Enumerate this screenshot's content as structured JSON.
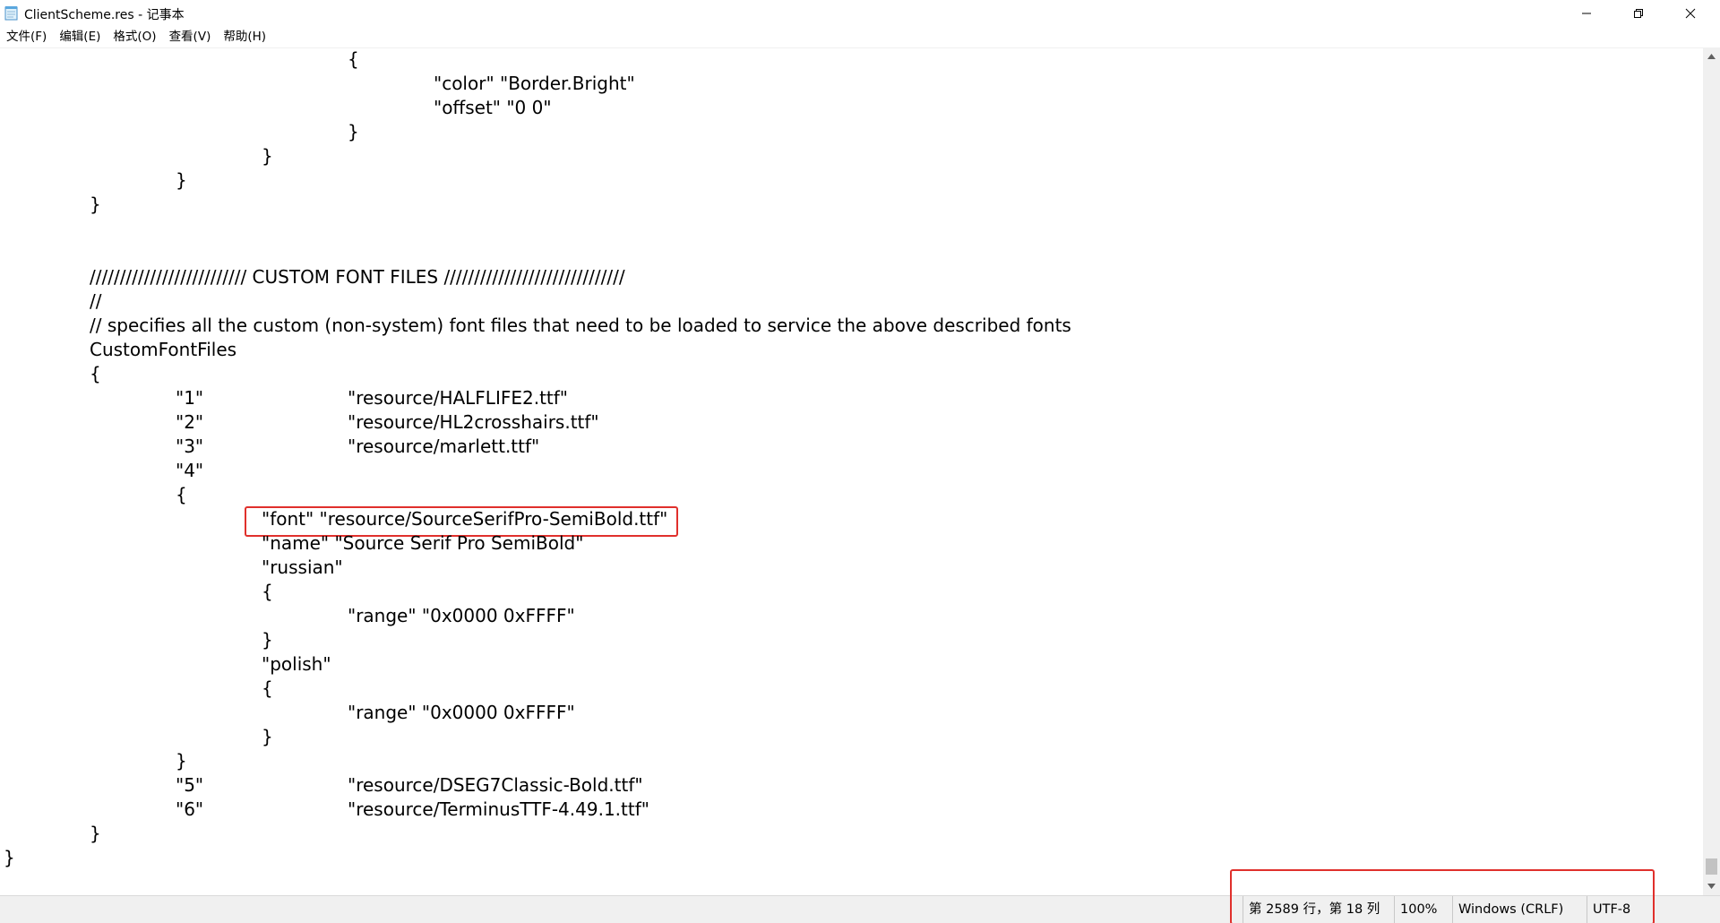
{
  "window": {
    "title": "ClientScheme.res - 记事本"
  },
  "menu": [
    {
      "label": "文件(F)"
    },
    {
      "label": "编辑(E)"
    },
    {
      "label": "格式(O)"
    },
    {
      "label": "查看(V)"
    },
    {
      "label": "帮助(H)"
    }
  ],
  "editor": {
    "lines": [
      {
        "indent": 4,
        "text": "{"
      },
      {
        "indent": 5,
        "text": "\"color\" \"Border.Bright\""
      },
      {
        "indent": 5,
        "text": "\"offset\" \"0 0\""
      },
      {
        "indent": 4,
        "text": "}"
      },
      {
        "indent": 3,
        "text": "}"
      },
      {
        "indent": 2,
        "text": "}"
      },
      {
        "indent": 1,
        "text": "}"
      },
      {
        "indent": 0,
        "text": ""
      },
      {
        "indent": 0,
        "text": ""
      },
      {
        "indent": 1,
        "text": "////////////////////////// CUSTOM FONT FILES //////////////////////////////"
      },
      {
        "indent": 1,
        "text": "//"
      },
      {
        "indent": 1,
        "text": "// specifies all the custom (non-system) font files that need to be loaded to service the above described fonts"
      },
      {
        "indent": 1,
        "text": "CustomFontFiles"
      },
      {
        "indent": 1,
        "text": "{"
      },
      {
        "indent": 2,
        "text": "\"1\"\t\t\"resource/HALFLIFE2.ttf\""
      },
      {
        "indent": 2,
        "text": "\"2\"\t\t\"resource/HL2crosshairs.ttf\""
      },
      {
        "indent": 2,
        "text": "\"3\"\t\t\"resource/marlett.ttf\""
      },
      {
        "indent": 2,
        "text": "\"4\""
      },
      {
        "indent": 2,
        "text": "{"
      },
      {
        "indent": 3,
        "text": "\"font\" \"resource/SourceSerifPro-SemiBold.ttf\""
      },
      {
        "indent": 3,
        "text": "\"name\" \"Source Serif Pro SemiBold\""
      },
      {
        "indent": 3,
        "text": "\"russian\""
      },
      {
        "indent": 3,
        "text": "{"
      },
      {
        "indent": 4,
        "text": "\"range\" \"0x0000 0xFFFF\""
      },
      {
        "indent": 3,
        "text": "}"
      },
      {
        "indent": 3,
        "text": "\"polish\""
      },
      {
        "indent": 3,
        "text": "{"
      },
      {
        "indent": 4,
        "text": "\"range\" \"0x0000 0xFFFF\""
      },
      {
        "indent": 3,
        "text": "}"
      },
      {
        "indent": 2,
        "text": "}"
      },
      {
        "indent": 2,
        "text": "\"5\"\t\t\"resource/DSEG7Classic-Bold.ttf\""
      },
      {
        "indent": 2,
        "text": "\"6\"\t\t\"resource/TerminusTTF-4.49.1.ttf\""
      },
      {
        "indent": 1,
        "text": "}"
      },
      {
        "indent": 0,
        "text": "}"
      }
    ]
  },
  "statusbar": {
    "position": "第 2589 行，第 18 列",
    "zoom": "100%",
    "line_ending": "Windows (CRLF)",
    "encoding": "UTF-8"
  },
  "colors": {
    "highlight": "#e0302c"
  }
}
